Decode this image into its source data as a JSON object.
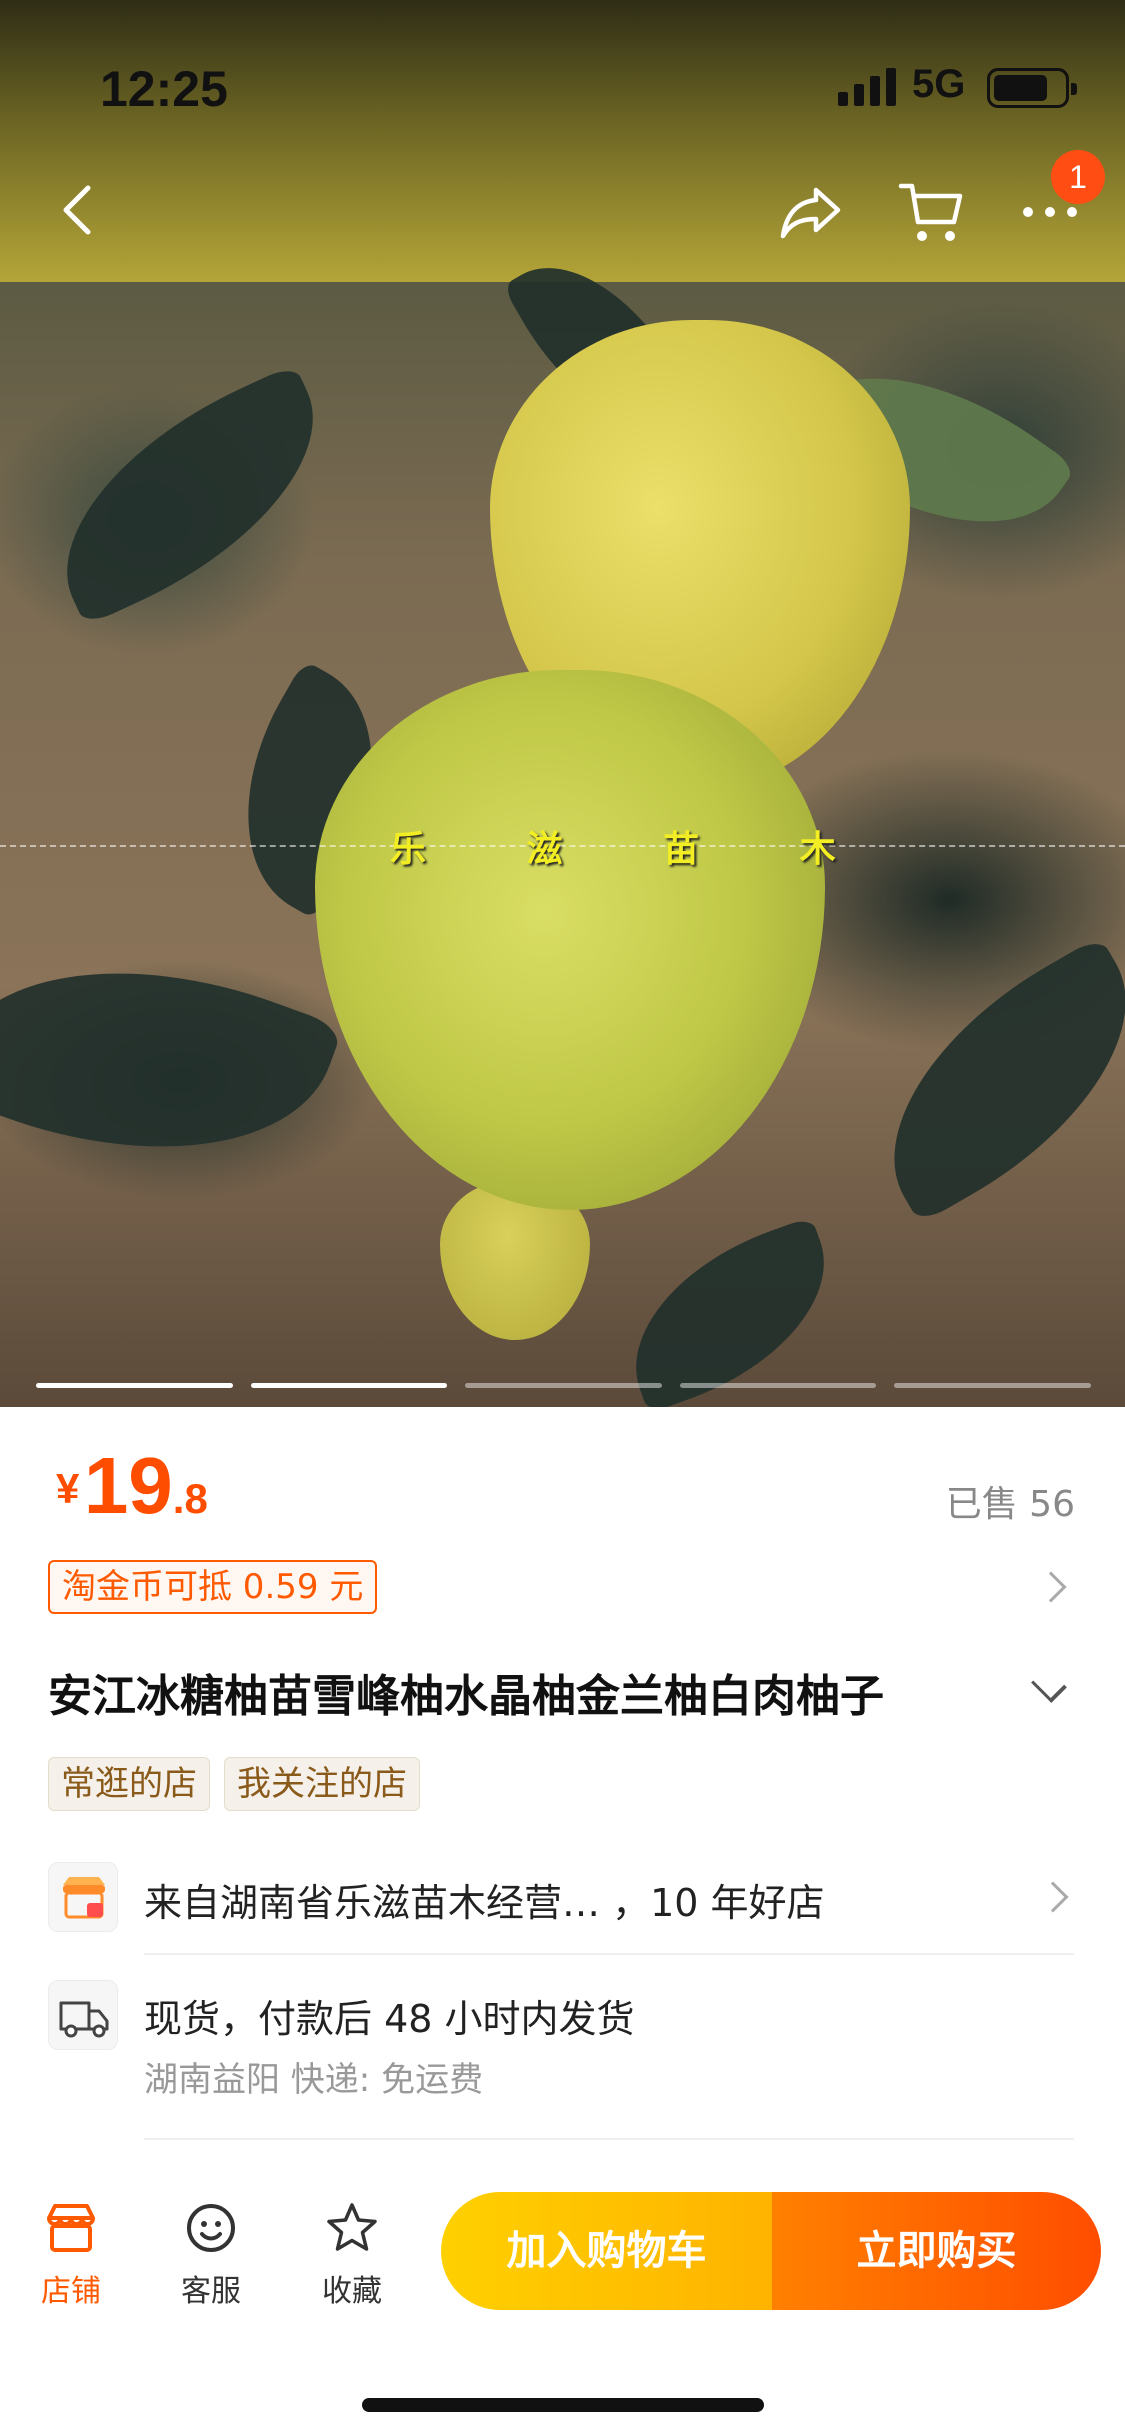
{
  "status_bar": {
    "time": "12:25",
    "network": "5G"
  },
  "nav": {
    "cart_badge": "1"
  },
  "hero": {
    "watermark": "乐 滋 苗 木",
    "slide_count": 5,
    "active_slides": 2
  },
  "product": {
    "price_symbol": "¥",
    "price_int": "19",
    "price_dec": ".8",
    "sold": "已售 56",
    "coupon": "淘金币可抵 0.59 元",
    "title": "安江冰糖柚苗雪峰柚水晶柚金兰柚白肉柚子",
    "tags": [
      "常逛的店",
      "我关注的店"
    ]
  },
  "shop_row": {
    "text": "来自湖南省乐滋苗木经营…  ，10 年好店"
  },
  "shipping_row": {
    "text": "现货，付款后 48 小时内发货",
    "sub": "湖南益阳  快递: 免运费"
  },
  "bottom_bar": {
    "tabs": [
      {
        "label": "店铺",
        "icon": "store-icon"
      },
      {
        "label": "客服",
        "icon": "service-icon"
      },
      {
        "label": "收藏",
        "icon": "star-icon"
      }
    ],
    "add_to_cart": "加入购物车",
    "buy_now": "立即购买"
  },
  "colors": {
    "accent": "#ff5a00",
    "buy": "#ff4d00",
    "cart": "#ffc400"
  }
}
